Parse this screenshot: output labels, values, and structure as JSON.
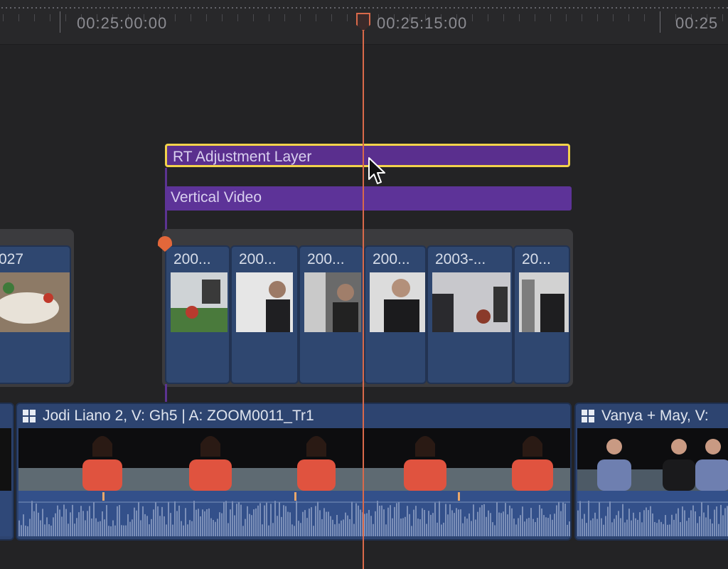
{
  "ruler": {
    "timecodes": [
      "00:25:00:00",
      "00:25:15:00",
      "00:25"
    ]
  },
  "connected_lane": {
    "adjustment_clip": "RT Adjustment Layer",
    "title_clip": "Vertical Video"
  },
  "storyline_clips": [
    {
      "label": "027"
    },
    {
      "label": "200..."
    },
    {
      "label": "200..."
    },
    {
      "label": "200..."
    },
    {
      "label": "200..."
    },
    {
      "label": "2003-..."
    },
    {
      "label": "20..."
    }
  ],
  "primary_clips": [
    {
      "label": "Jodi Liano 2, V: Gh5 | A: ZOOM0011_Tr1"
    },
    {
      "label": "Vanya + May, V:"
    }
  ],
  "colors": {
    "accent_selection": "#f2d24b",
    "adjustment_purple": "#5a2f8e",
    "clip_blue": "#2f4770",
    "playhead": "#d9694a"
  },
  "icons": [
    "clip-grid-icon",
    "playhead-icon",
    "mouse-pointer-icon",
    "marker-icon"
  ]
}
